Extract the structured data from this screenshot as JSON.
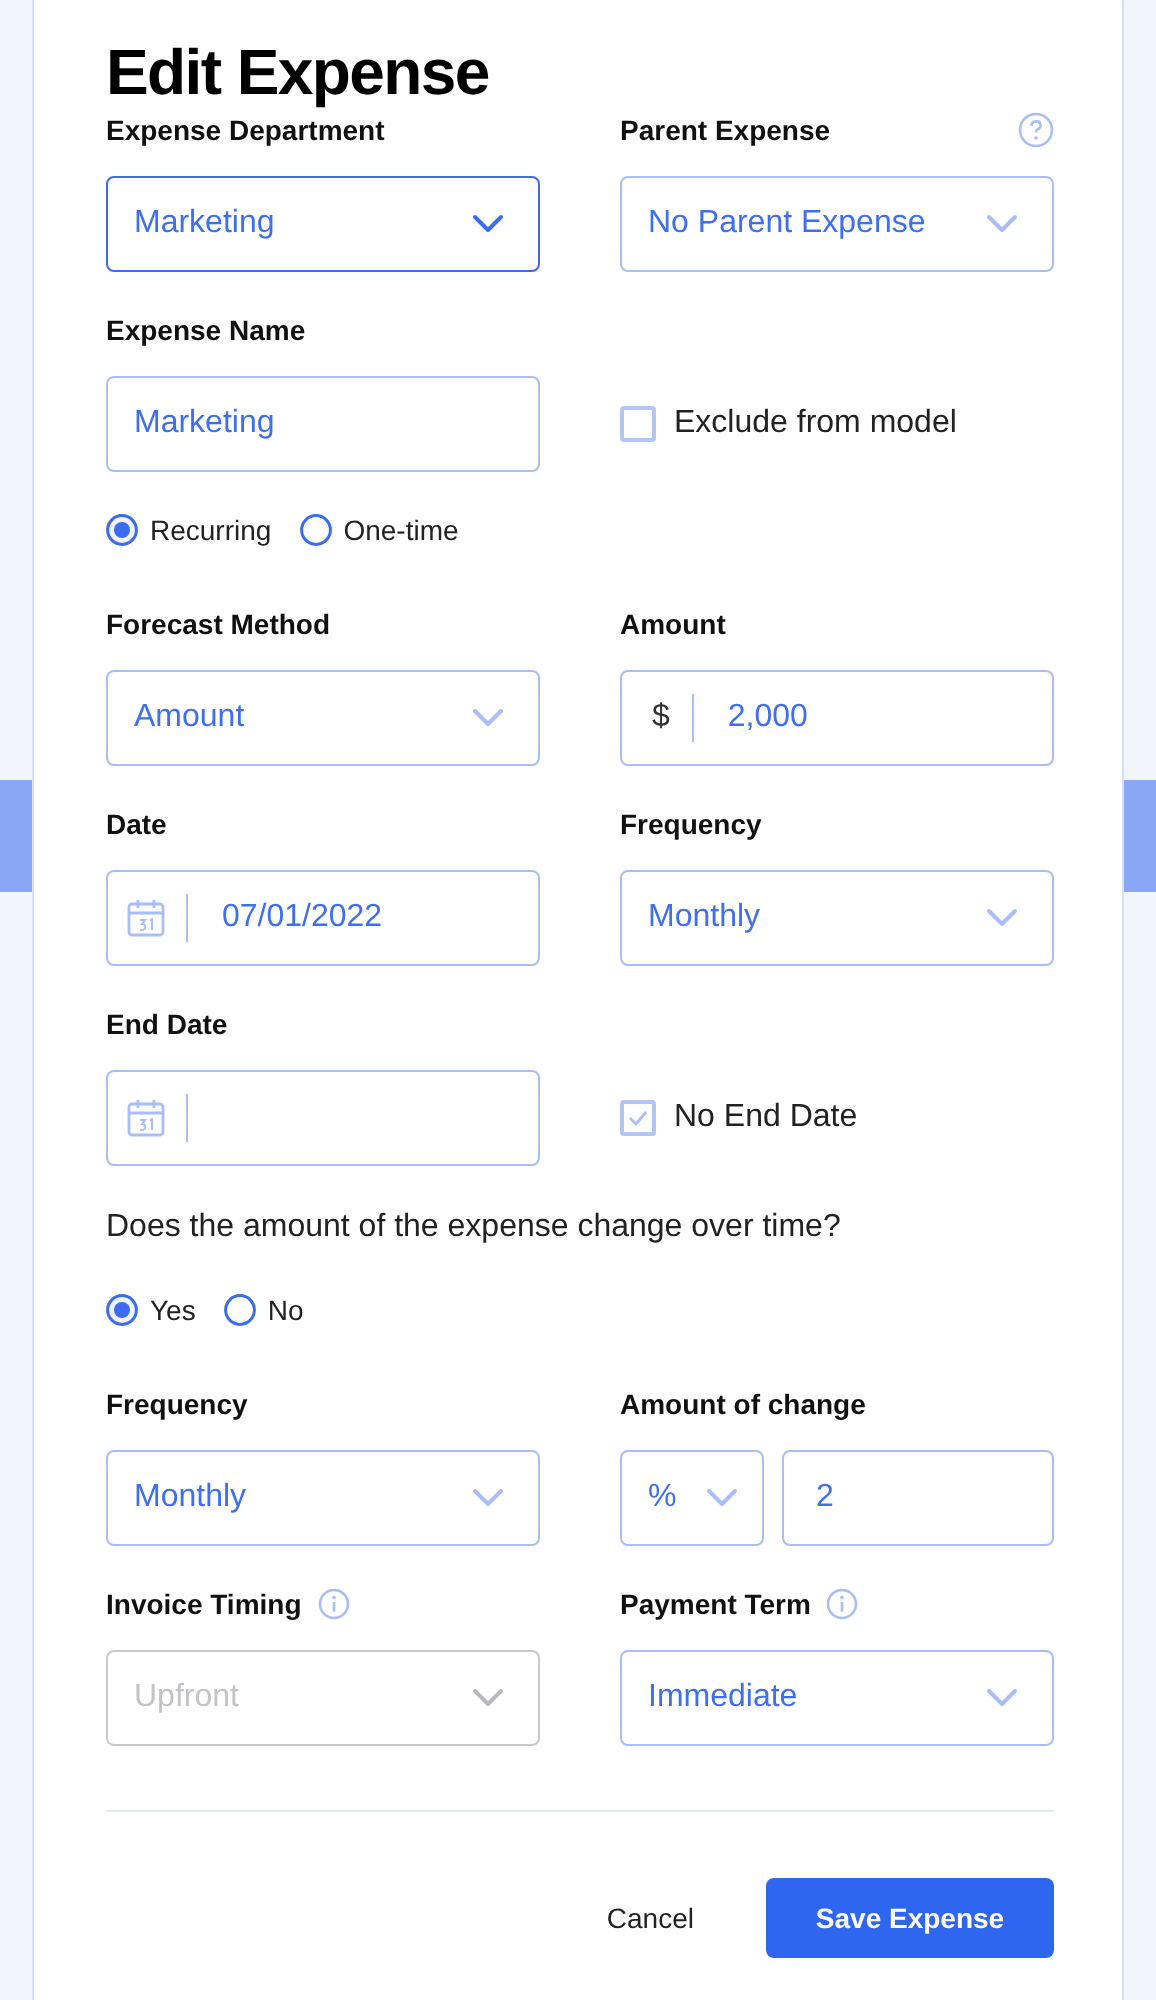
{
  "title": "Edit Expense",
  "rows": [
    {
      "cells": [
        {
          "kind": "select",
          "label": "Expense Department",
          "value": "Marketing",
          "focused": true,
          "disabled": false
        },
        {
          "kind": "select",
          "label": "Parent Expense",
          "value": "No Parent Expense",
          "help": true,
          "focused": false,
          "disabled": false
        }
      ]
    },
    {
      "cells": [
        {
          "kind": "input",
          "label": "Expense Name",
          "value": "Marketing"
        },
        {
          "kind": "checkbox",
          "label": "Exclude from model",
          "checked": false
        }
      ]
    },
    {
      "cells": [
        {
          "kind": "radio",
          "options": [
            {
              "label": "Recurring",
              "selected": true
            },
            {
              "label": "One-time",
              "selected": false
            }
          ]
        }
      ]
    },
    {
      "cells": [
        {
          "kind": "select",
          "label": "Forecast Method",
          "value": "Amount",
          "focused": false,
          "disabled": false
        },
        {
          "kind": "money",
          "label": "Amount",
          "unit": "$",
          "value": "2,000"
        }
      ]
    },
    {
      "cells": [
        {
          "kind": "date",
          "label": "Date",
          "value": "07/01/2022"
        },
        {
          "kind": "select",
          "label": "Frequency",
          "value": "Monthly",
          "focused": false,
          "disabled": false
        }
      ]
    },
    {
      "cells": [
        {
          "kind": "date",
          "label": "End Date"
        },
        {
          "kind": "checkbox",
          "label": "No End Date",
          "checked": true
        }
      ]
    },
    {
      "cells": [
        {
          "kind": "question",
          "text": "Does the amount of the expense change over time?"
        }
      ]
    },
    {
      "cells": [
        {
          "kind": "radio",
          "options": [
            {
              "label": "Yes",
              "selected": true
            },
            {
              "label": "No",
              "selected": false
            }
          ]
        }
      ]
    },
    {
      "cells": [
        {
          "kind": "select",
          "label": "Frequency",
          "value": "Monthly",
          "focused": false,
          "disabled": false
        },
        {
          "kind": "change",
          "label": "Amount of change",
          "unit": "%",
          "value": "2"
        }
      ]
    },
    {
      "cells": [
        {
          "kind": "select",
          "label": "Invoice Timing",
          "value": "Upfront",
          "info": true,
          "focused": false,
          "disabled": true
        },
        {
          "kind": "select",
          "label": "Payment Term",
          "value": "Immediate",
          "info": true,
          "focused": false,
          "disabled": false
        }
      ]
    }
  ],
  "footer": {
    "cancel": "Cancel",
    "save": "Save Expense"
  }
}
